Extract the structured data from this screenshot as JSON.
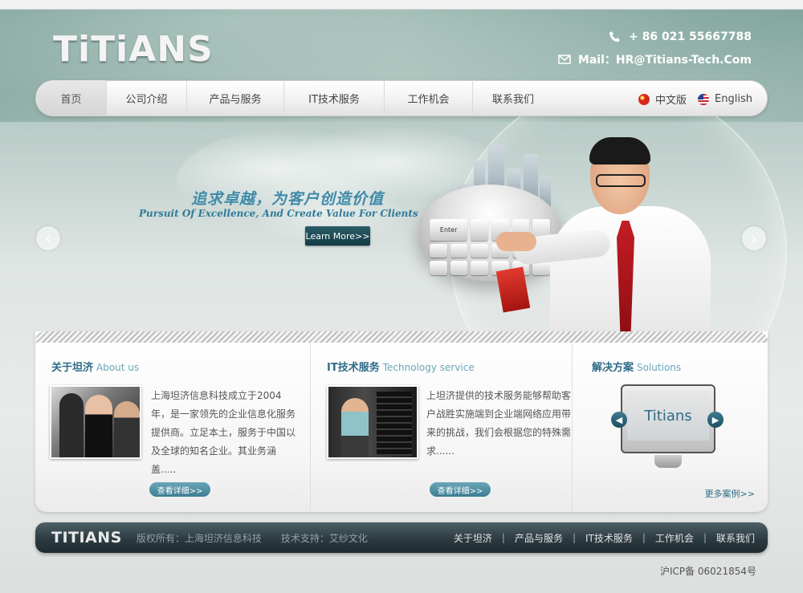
{
  "header": {
    "logo": "TiTiANS",
    "phone": "+ 86  021  55667788",
    "mail": "Mail：HR@Titians-Tech.Com"
  },
  "nav": {
    "items": [
      "首页",
      "公司介绍",
      "产品与服务",
      "IT技术服务",
      "工作机会",
      "联系我们"
    ],
    "lang_cn": "中文版",
    "lang_en": "English"
  },
  "banner": {
    "slogan_cn": "追求卓越，为客户创造价值",
    "slogan_en": "Pursuit Of Excellence, And Create Value For Clients",
    "learn_more": "Learn More>>",
    "prev": "‹",
    "next": "›",
    "enter_key": "Enter"
  },
  "about": {
    "title": "关于坦济",
    "title_en": "About us",
    "desc": "上海坦济信息科技成立于2004年，是一家领先的企业信息化服务提供商。立足本土，服务于中国以及全球的知名企业。其业务涵盖.....",
    "button": "查看详细>>"
  },
  "service": {
    "title": "IT技术服务",
    "title_en": "Technology service",
    "desc": "上坦济提供的技术服务能够帮助客户战胜实施端到企业端网络应用带来的挑战，我们会根据您的特殊需求......",
    "button": "查看详细>>"
  },
  "solutions": {
    "title": "解决方案",
    "title_en": "Solutions",
    "screen_text": "Titians",
    "more": "更多案例>>"
  },
  "footer": {
    "logo": "TITIANS",
    "copyright": "版权所有：上海坦济信息科技",
    "tech": "技术支持：艾纱文化",
    "links": [
      "关于坦济",
      "产品与服务",
      "IT技术服务",
      "工作机会",
      "联系我们"
    ],
    "icp": "沪ICP备 06021854号"
  }
}
